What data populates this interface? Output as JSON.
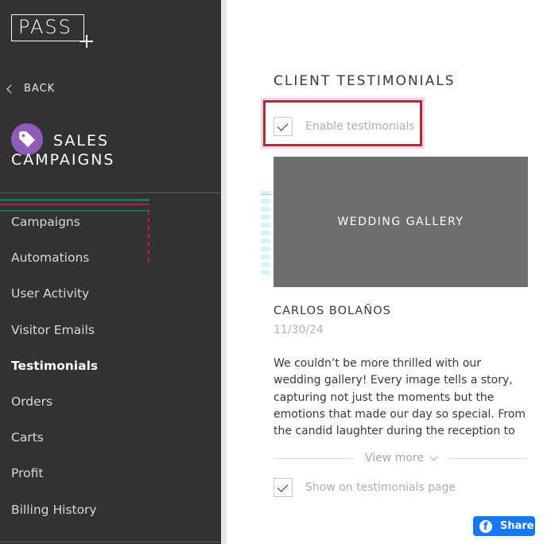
{
  "brand": {
    "logo_text": "PASS"
  },
  "sidebar": {
    "back_label": "BACK",
    "section_title": "SALES CAMPAIGNS",
    "section_icon": "tag-icon",
    "section_icon_color": "#8e5cb8",
    "items": [
      {
        "label": "Campaigns",
        "active": false
      },
      {
        "label": "Automations",
        "active": false
      },
      {
        "label": "User Activity",
        "active": false
      },
      {
        "label": "Visitor Emails",
        "active": false
      },
      {
        "label": "Testimonials",
        "active": true
      },
      {
        "label": "Orders",
        "active": false
      },
      {
        "label": "Carts",
        "active": false
      },
      {
        "label": "Profit",
        "active": false
      },
      {
        "label": "Billing History",
        "active": false
      }
    ]
  },
  "main": {
    "heading": "CLIENT TESTIMONIALS",
    "enable_checkbox": {
      "label": "Enable testimonials",
      "checked": true
    },
    "gallery": {
      "label": "WEDDING GALLERY"
    },
    "testimonial": {
      "author": "CARLOS BOLAÑOS",
      "date": "11/30/24",
      "text": "We couldn’t be more thrilled with our wedding gallery! Every image tells a story, capturing not just the moments but the emotions that made our day so special. From the candid laughter during the reception to the tender glances we"
    },
    "view_more_label": "View more",
    "show_checkbox": {
      "label": "Show on testimonials page",
      "checked": true
    }
  },
  "share": {
    "label": "Share",
    "icon": "facebook-icon",
    "color": "#1877f2"
  },
  "colors": {
    "sidebar_bg": "#323232",
    "highlight_border": "#a8322d",
    "gallery_bg": "#6e6e6e"
  }
}
